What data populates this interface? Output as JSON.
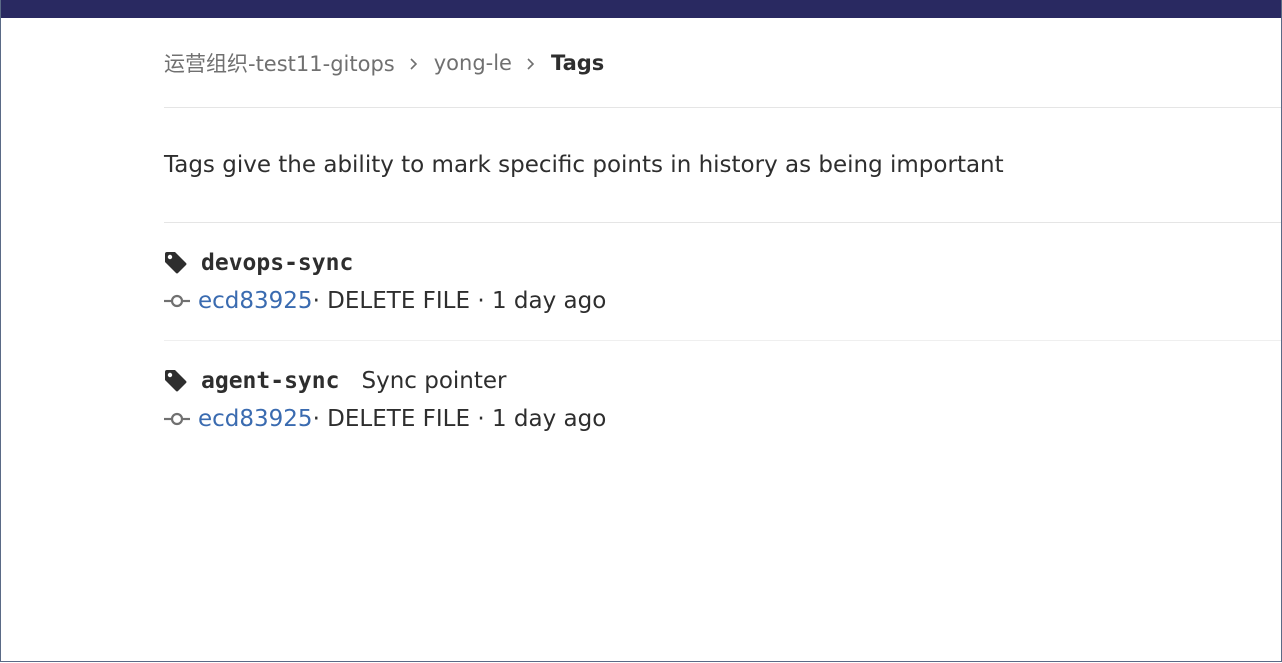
{
  "breadcrumb": {
    "group": "运营组织-test11-gitops",
    "project": "yong-le",
    "current": "Tags"
  },
  "description": "Tags give the ability to mark specific points in history as being important",
  "tags": [
    {
      "name": "devops-sync",
      "message": "",
      "commit_sha": "ecd83925",
      "commit_meta": " · DELETE FILE · 1 day ago"
    },
    {
      "name": "agent-sync",
      "message": "Sync pointer",
      "commit_sha": "ecd83925",
      "commit_meta": " · DELETE FILE · 1 day ago"
    }
  ],
  "colors": {
    "top_bar": "#292961",
    "link": "#3a6bb0",
    "text": "#2e2e2e",
    "muted": "#707070"
  },
  "icons": {
    "tag": "tag-icon",
    "commit": "commit-icon",
    "chevron": "chevron-right-icon"
  }
}
